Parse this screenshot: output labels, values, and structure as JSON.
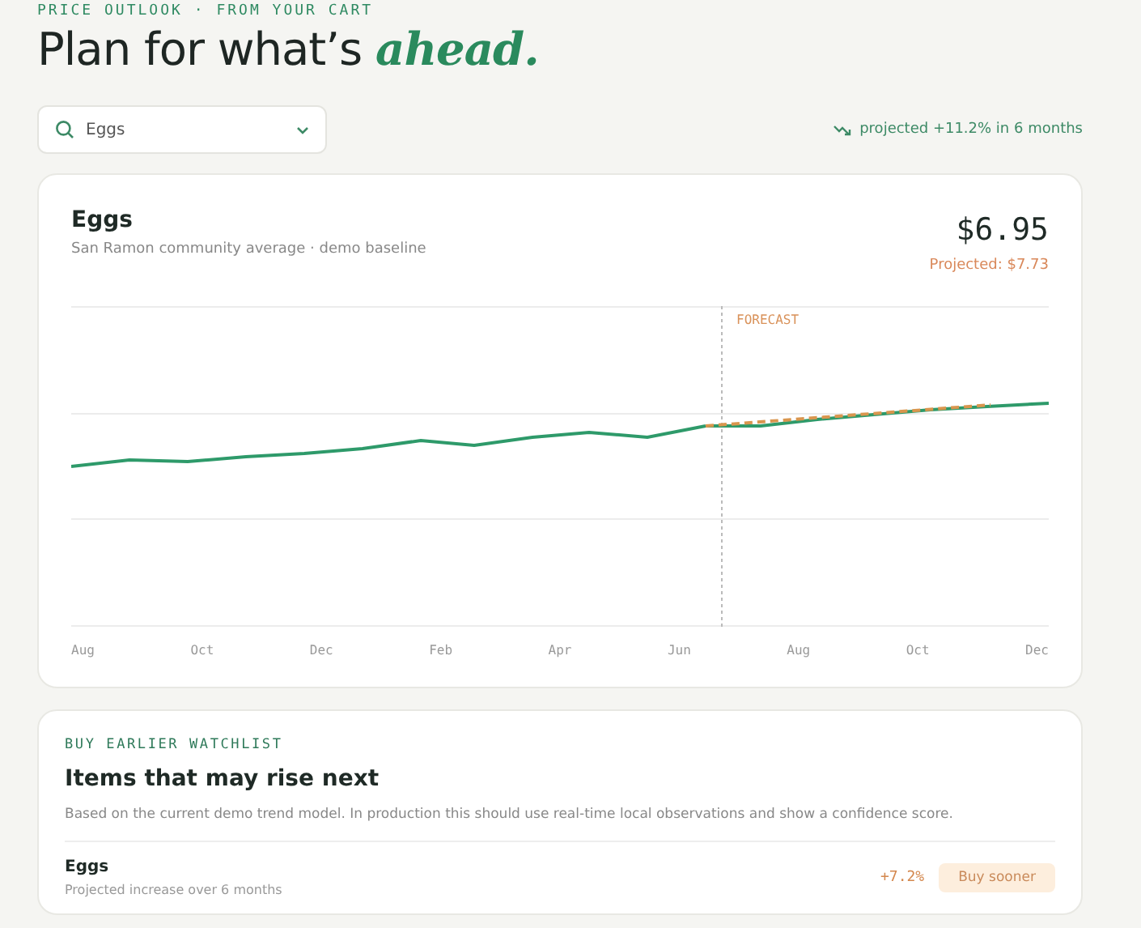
{
  "eyebrow": "PRICE OUTLOOK · FROM YOUR CART",
  "headline": {
    "text": "Plan for what’s",
    "accent": "ahead."
  },
  "search": {
    "value": "Eggs"
  },
  "trend": "projected +11.2% in 6 months",
  "price_card": {
    "title": "Eggs",
    "subtitle": "San Ramon community average · demo baseline",
    "price": "$6.95",
    "projected": "Projected: $7.73",
    "chart": {
      "forecast_label": "FORECAST",
      "x_labels": [
        "Aug",
        "Oct",
        "Dec",
        "Feb",
        "Apr",
        "Jun",
        "Aug",
        "Oct",
        "Dec"
      ]
    }
  },
  "watchlist": {
    "eyebrow": "BUY EARLIER WATCHLIST",
    "title": "Items that may rise next",
    "note": "Based on the current demo trend model. In production this should use real-time local observations and show a confidence score.",
    "items": [
      {
        "name": "Eggs",
        "detail": "Projected increase over 6 months",
        "change": "+7.2%",
        "action": "Buy sooner"
      }
    ]
  }
}
